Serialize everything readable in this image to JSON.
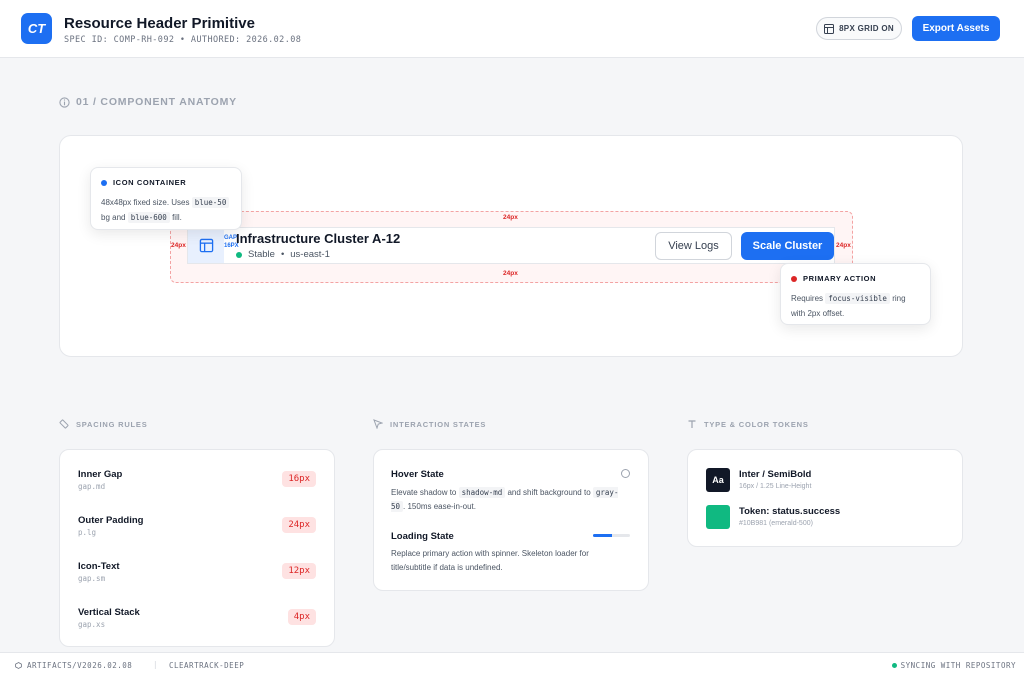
{
  "header": {
    "logo_text": "CT",
    "title": "Resource Header Primitive",
    "meta": "SPEC ID: COMP-RH-092 • AUTHORED: 2026.02.08",
    "grid_toggle_label": "8PX GRID ON",
    "export_label": "Export Assets"
  },
  "anatomy": {
    "section_title": "01 / COMPONENT ANATOMY",
    "resource_title": "Infrastructure Cluster A-12",
    "status_text": "Stable",
    "region_text": "us-east-1",
    "status_separator": "•",
    "secondary_action": "View Logs",
    "primary_action": "Scale Cluster",
    "padding_label": "24px",
    "gap_label_top": "GAP",
    "gap_label_bottom": "16PX",
    "icon_callout": {
      "title": "ICON CONTAINER",
      "text_1": "48x48px fixed size. Uses",
      "code_1": "blue-50",
      "text_2": "bg and",
      "code_2": "blue-600",
      "text_3": "fill."
    },
    "action_callout": {
      "title": "PRIMARY ACTION",
      "text_1": "Requires",
      "code_1": "focus-visible",
      "text_2": "ring with 2px offset."
    }
  },
  "spacing": {
    "section_title": "SPACING RULES",
    "rules": [
      {
        "name": "Inner Gap",
        "token": "gap.md",
        "value": "16px"
      },
      {
        "name": "Outer Padding",
        "token": "p.lg",
        "value": "24px"
      },
      {
        "name": "Icon-Text",
        "token": "gap.sm",
        "value": "12px"
      },
      {
        "name": "Vertical Stack",
        "token": "gap.xs",
        "value": "4px"
      }
    ]
  },
  "states": {
    "section_title": "INTERACTION STATES",
    "hover": {
      "title": "Hover State",
      "text_1": "Elevate shadow to",
      "code_1": "shadow-md",
      "text_2": "and shift background to",
      "code_2": "gray-50",
      "text_3": ". 150ms ease-in-out."
    },
    "loading": {
      "title": "Loading State",
      "text": "Replace primary action with spinner. Skeleton loader for title/subtitle if data is undefined.",
      "progress": 0.5
    }
  },
  "tokens": {
    "section_title": "TYPE & COLOR TOKENS",
    "type": {
      "glyph": "Aa",
      "name": "Inter / SemiBold",
      "meta": "16px / 1.25 Line-Height"
    },
    "color": {
      "name": "Token: status.success",
      "meta": "#10B981 (emerald-500)",
      "hex": "#10B981"
    }
  },
  "footer": {
    "artifact": "ARTIFACTS/V2026.02.08",
    "separator": "|",
    "project": "CLEARTRACK-DEEP",
    "sync": "SYNCING WITH REPOSITORY"
  },
  "colors": {
    "accent": "#1D6FF2",
    "danger": "#DC2626",
    "success": "#10B981"
  }
}
